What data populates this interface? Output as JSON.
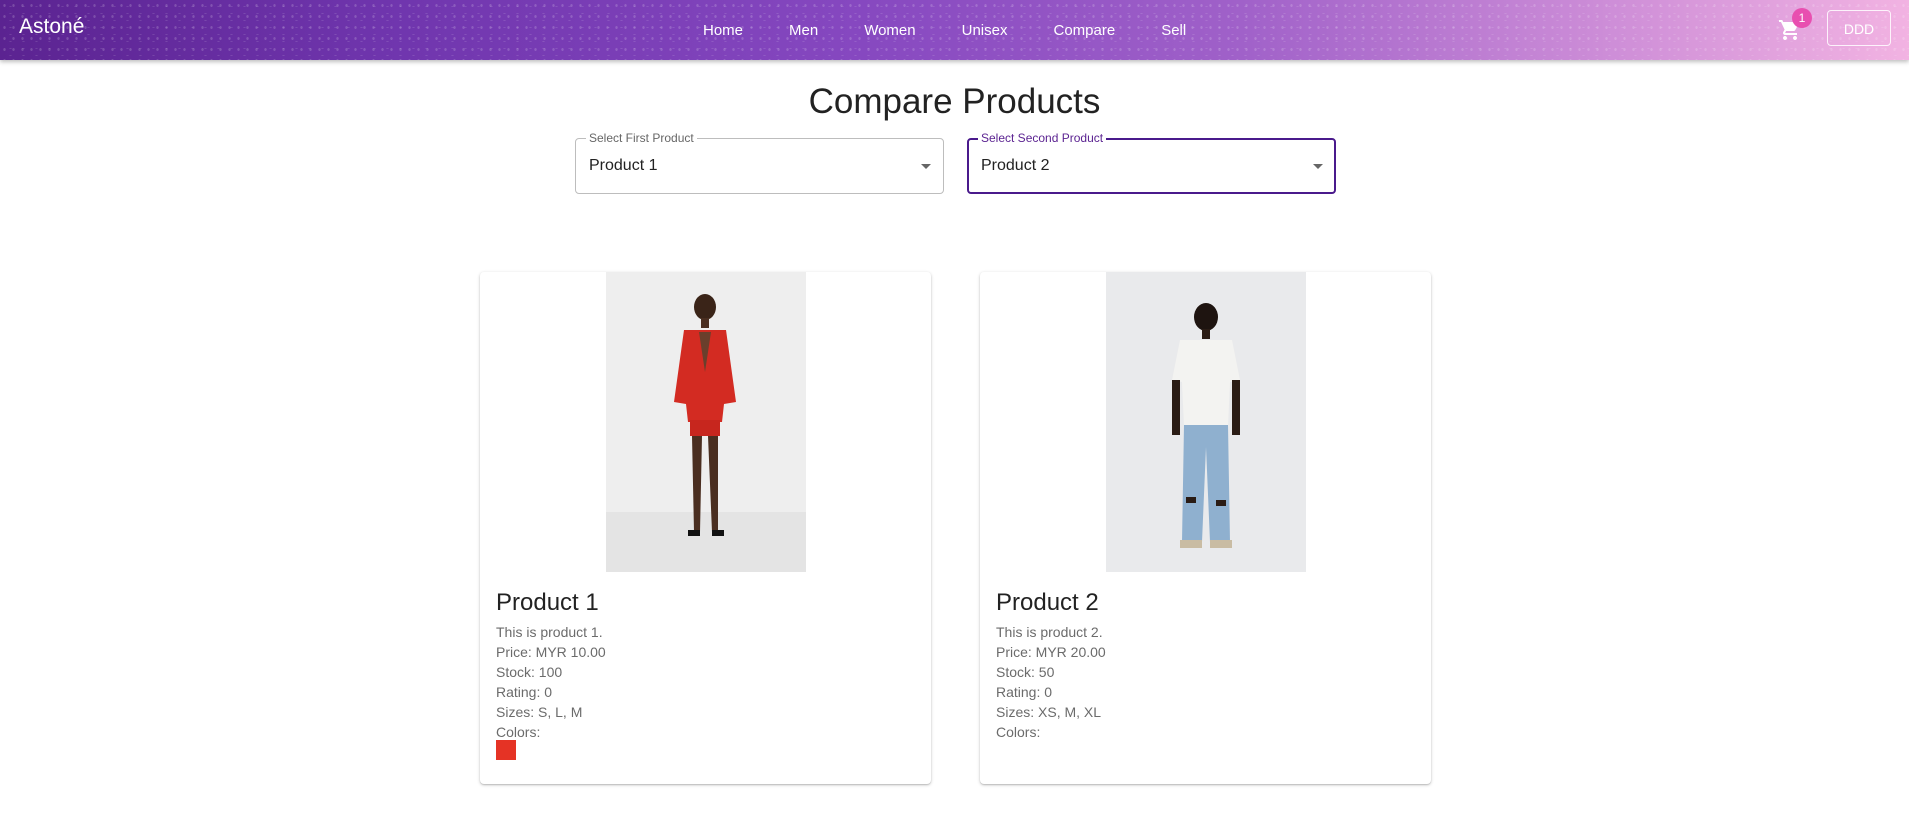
{
  "header": {
    "brand": "Astoné",
    "nav": [
      "Home",
      "Men",
      "Women",
      "Unisex",
      "Compare",
      "Sell"
    ],
    "cart_count": "1",
    "user_label": "DDD",
    "accent_colors": [
      "#5b2391",
      "#f2b3e2"
    ]
  },
  "main": {
    "title": "Compare Products",
    "first_select": {
      "label": "Select First Product",
      "value": "Product 1"
    },
    "second_select": {
      "label": "Select Second Product",
      "value": "Product 2"
    }
  },
  "products": [
    {
      "name": "Product 1",
      "description": "This is product 1.",
      "price": "Price: MYR 10.00",
      "stock": "Stock: 100",
      "rating": "Rating: 0",
      "sizes": "Sizes: S, L, M",
      "colors_label": "Colors:",
      "colors": [
        "#e53325"
      ]
    },
    {
      "name": "Product 2",
      "description": "This is product 2.",
      "price": "Price: MYR 20.00",
      "stock": "Stock: 50",
      "rating": "Rating: 0",
      "sizes": "Sizes: XS, M, XL",
      "colors_label": "Colors:",
      "colors": []
    }
  ]
}
